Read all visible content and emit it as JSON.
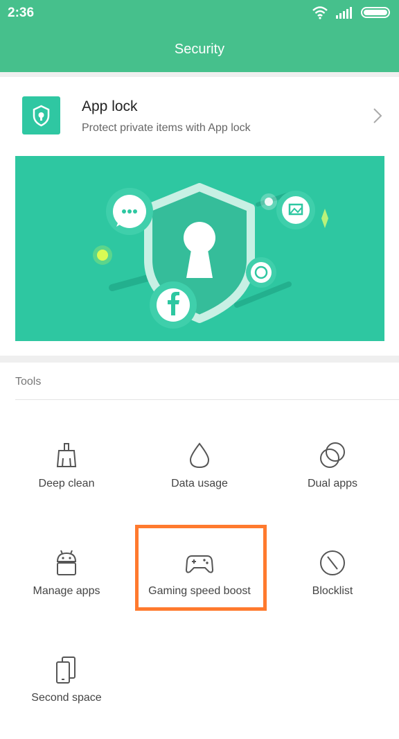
{
  "status": {
    "time": "2:36"
  },
  "header": {
    "title": "Security"
  },
  "app_lock": {
    "title": "App lock",
    "subtitle": "Protect private items with App lock"
  },
  "tools": {
    "section_label": "Tools",
    "items": [
      {
        "label": "Deep clean",
        "icon": "broom-icon"
      },
      {
        "label": "Data usage",
        "icon": "droplet-icon"
      },
      {
        "label": "Dual apps",
        "icon": "dual-circles-icon"
      },
      {
        "label": "Manage apps",
        "icon": "android-icon"
      },
      {
        "label": "Gaming speed boost",
        "icon": "gamepad-icon"
      },
      {
        "label": "Blocklist",
        "icon": "block-icon"
      },
      {
        "label": "Second space",
        "icon": "phones-icon"
      }
    ]
  },
  "colors": {
    "header": "#46c08c",
    "banner": "#2ec7a1",
    "highlight": "#ff7a2e"
  }
}
